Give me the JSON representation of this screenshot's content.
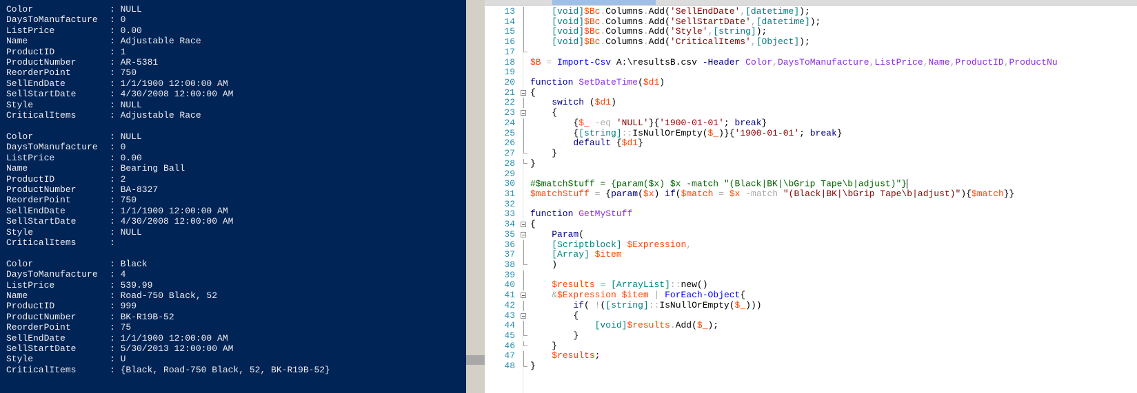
{
  "console": {
    "records": [
      [
        {
          "k": "Color",
          "v": "NULL"
        },
        {
          "k": "DaysToManufacture",
          "v": "0"
        },
        {
          "k": "ListPrice",
          "v": "0.00"
        },
        {
          "k": "Name",
          "v": "Adjustable Race"
        },
        {
          "k": "ProductID",
          "v": "1"
        },
        {
          "k": "ProductNumber",
          "v": "AR-5381"
        },
        {
          "k": "ReorderPoint",
          "v": "750"
        },
        {
          "k": "SellEndDate",
          "v": "1/1/1900 12:00:00 AM"
        },
        {
          "k": "SellStartDate",
          "v": "4/30/2008 12:00:00 AM"
        },
        {
          "k": "Style",
          "v": "NULL"
        },
        {
          "k": "CriticalItems",
          "v": "Adjustable Race"
        }
      ],
      [
        {
          "k": "Color",
          "v": "NULL"
        },
        {
          "k": "DaysToManufacture",
          "v": "0"
        },
        {
          "k": "ListPrice",
          "v": "0.00"
        },
        {
          "k": "Name",
          "v": "Bearing Ball"
        },
        {
          "k": "ProductID",
          "v": "2"
        },
        {
          "k": "ProductNumber",
          "v": "BA-8327"
        },
        {
          "k": "ReorderPoint",
          "v": "750"
        },
        {
          "k": "SellEndDate",
          "v": "1/1/1900 12:00:00 AM"
        },
        {
          "k": "SellStartDate",
          "v": "4/30/2008 12:00:00 AM"
        },
        {
          "k": "Style",
          "v": "NULL"
        },
        {
          "k": "CriticalItems",
          "v": ""
        }
      ],
      [
        {
          "k": "Color",
          "v": "Black"
        },
        {
          "k": "DaysToManufacture",
          "v": "4"
        },
        {
          "k": "ListPrice",
          "v": "539.99"
        },
        {
          "k": "Name",
          "v": "Road-750 Black, 52"
        },
        {
          "k": "ProductID",
          "v": "999"
        },
        {
          "k": "ProductNumber",
          "v": "BK-R19B-52"
        },
        {
          "k": "ReorderPoint",
          "v": "75"
        },
        {
          "k": "SellEndDate",
          "v": "1/1/1900 12:00:00 AM"
        },
        {
          "k": "SellStartDate",
          "v": "5/30/2013 12:00:00 AM"
        },
        {
          "k": "Style",
          "v": "U"
        },
        {
          "k": "CriticalItems",
          "v": "{Black, Road-750 Black, 52, BK-R19B-52}"
        }
      ]
    ]
  },
  "colors": {
    "console_bg": "#012456",
    "console_fg": "#eeedf0",
    "line_number": "#2b91af",
    "variable": "#ff4500",
    "type": "#008080",
    "string": "#8b0000",
    "keyword": "#00008b",
    "command": "#0000ff",
    "comment": "#006400",
    "argument": "#8a2be2"
  },
  "editor": {
    "lines": [
      {
        "n": "13",
        "fold": "line",
        "t": [
          [
            "plain",
            "    "
          ],
          [
            "type",
            "[void]"
          ],
          [
            "var",
            "$Bc"
          ],
          [
            "op",
            "."
          ],
          [
            "member",
            "Columns"
          ],
          [
            "op",
            "."
          ],
          [
            "member",
            "Add"
          ],
          [
            "grp",
            "("
          ],
          [
            "str",
            "'SellEndDate'"
          ],
          [
            "op",
            ","
          ],
          [
            "type",
            "[datetime]"
          ],
          [
            "grp",
            ");"
          ]
        ]
      },
      {
        "n": "14",
        "fold": "line",
        "t": [
          [
            "plain",
            "    "
          ],
          [
            "type",
            "[void]"
          ],
          [
            "var",
            "$Bc"
          ],
          [
            "op",
            "."
          ],
          [
            "member",
            "Columns"
          ],
          [
            "op",
            "."
          ],
          [
            "member",
            "Add"
          ],
          [
            "grp",
            "("
          ],
          [
            "str",
            "'SellStartDate'"
          ],
          [
            "op",
            ","
          ],
          [
            "type",
            "[datetime]"
          ],
          [
            "grp",
            ");"
          ]
        ]
      },
      {
        "n": "15",
        "fold": "line",
        "t": [
          [
            "plain",
            "    "
          ],
          [
            "type",
            "[void]"
          ],
          [
            "var",
            "$Bc"
          ],
          [
            "op",
            "."
          ],
          [
            "member",
            "Columns"
          ],
          [
            "op",
            "."
          ],
          [
            "member",
            "Add"
          ],
          [
            "grp",
            "("
          ],
          [
            "str",
            "'Style'"
          ],
          [
            "op",
            ","
          ],
          [
            "type",
            "[string]"
          ],
          [
            "grp",
            ");"
          ]
        ]
      },
      {
        "n": "16",
        "fold": "line",
        "t": [
          [
            "plain",
            "    "
          ],
          [
            "type",
            "[void]"
          ],
          [
            "var",
            "$Bc"
          ],
          [
            "op",
            "."
          ],
          [
            "member",
            "Columns"
          ],
          [
            "op",
            "."
          ],
          [
            "member",
            "Add"
          ],
          [
            "grp",
            "("
          ],
          [
            "str",
            "'CriticalItems'"
          ],
          [
            "op",
            ","
          ],
          [
            "type",
            "[Object]"
          ],
          [
            "grp",
            ");"
          ]
        ]
      },
      {
        "n": "17",
        "fold": "end",
        "t": []
      },
      {
        "n": "18",
        "fold": "",
        "t": [
          [
            "var",
            "$B"
          ],
          [
            "plain",
            " "
          ],
          [
            "op",
            "="
          ],
          [
            "plain",
            " "
          ],
          [
            "cmd",
            "Import-Csv"
          ],
          [
            "plain",
            " "
          ],
          [
            "plain",
            "A:\\resultsB.csv"
          ],
          [
            "plain",
            " "
          ],
          [
            "param",
            "-Header"
          ],
          [
            "plain",
            " "
          ],
          [
            "arg",
            "Color"
          ],
          [
            "op",
            ","
          ],
          [
            "arg",
            "DaysToManufacture"
          ],
          [
            "op",
            ","
          ],
          [
            "arg",
            "ListPrice"
          ],
          [
            "op",
            ","
          ],
          [
            "arg",
            "Name"
          ],
          [
            "op",
            ","
          ],
          [
            "arg",
            "ProductID"
          ],
          [
            "op",
            ","
          ],
          [
            "arg",
            "ProductNu"
          ]
        ]
      },
      {
        "n": "19",
        "fold": "",
        "t": []
      },
      {
        "n": "20",
        "fold": "",
        "t": [
          [
            "kw",
            "function"
          ],
          [
            "plain",
            " "
          ],
          [
            "arg",
            "SetDateTime"
          ],
          [
            "grp",
            "("
          ],
          [
            "var",
            "$d1"
          ],
          [
            "grp",
            ")"
          ]
        ]
      },
      {
        "n": "21",
        "fold": "box",
        "t": [
          [
            "grp",
            "{"
          ]
        ]
      },
      {
        "n": "22",
        "fold": "line",
        "t": [
          [
            "plain",
            "    "
          ],
          [
            "kw",
            "switch"
          ],
          [
            "plain",
            " "
          ],
          [
            "grp",
            "("
          ],
          [
            "var",
            "$d1"
          ],
          [
            "grp",
            ")"
          ]
        ]
      },
      {
        "n": "23",
        "fold": "box",
        "t": [
          [
            "plain",
            "    "
          ],
          [
            "grp",
            "{"
          ]
        ]
      },
      {
        "n": "24",
        "fold": "line",
        "t": [
          [
            "plain",
            "        "
          ],
          [
            "grp",
            "{"
          ],
          [
            "var",
            "$_"
          ],
          [
            "plain",
            " "
          ],
          [
            "op",
            "-eq"
          ],
          [
            "plain",
            " "
          ],
          [
            "str",
            "'NULL'"
          ],
          [
            "grp",
            "}{"
          ],
          [
            "str",
            "'1900-01-01'"
          ],
          [
            "plain",
            "; "
          ],
          [
            "kw",
            "break"
          ],
          [
            "grp",
            "}"
          ]
        ]
      },
      {
        "n": "25",
        "fold": "line",
        "t": [
          [
            "plain",
            "        "
          ],
          [
            "grp",
            "{"
          ],
          [
            "type",
            "[string]"
          ],
          [
            "op",
            "::"
          ],
          [
            "member",
            "IsNullOrEmpty"
          ],
          [
            "grp",
            "("
          ],
          [
            "var",
            "$_"
          ],
          [
            "grp",
            ")}{"
          ],
          [
            "str",
            "'1900-01-01'"
          ],
          [
            "plain",
            "; "
          ],
          [
            "kw",
            "break"
          ],
          [
            "grp",
            "}"
          ]
        ]
      },
      {
        "n": "26",
        "fold": "line",
        "t": [
          [
            "plain",
            "        "
          ],
          [
            "kw",
            "default"
          ],
          [
            "plain",
            " "
          ],
          [
            "grp",
            "{"
          ],
          [
            "var",
            "$d1"
          ],
          [
            "grp",
            "}"
          ]
        ]
      },
      {
        "n": "27",
        "fold": "end",
        "t": [
          [
            "plain",
            "    "
          ],
          [
            "grp",
            "}"
          ]
        ]
      },
      {
        "n": "28",
        "fold": "end",
        "t": [
          [
            "grp",
            "}"
          ]
        ]
      },
      {
        "n": "29",
        "fold": "",
        "t": []
      },
      {
        "n": "30",
        "fold": "",
        "t": [
          [
            "com",
            "#$matchStuff = {param($x) $x -match \"(Black|BK|\\bGrip Tape\\b|adjust)\"}"
          ],
          [
            "caret",
            ""
          ]
        ]
      },
      {
        "n": "31",
        "fold": "",
        "t": [
          [
            "var",
            "$matchStuff"
          ],
          [
            "plain",
            " "
          ],
          [
            "op",
            "="
          ],
          [
            "plain",
            " "
          ],
          [
            "grp",
            "{"
          ],
          [
            "kw",
            "param"
          ],
          [
            "grp",
            "("
          ],
          [
            "var",
            "$x"
          ],
          [
            "grp",
            ")"
          ],
          [
            "plain",
            " "
          ],
          [
            "kw",
            "if"
          ],
          [
            "grp",
            "("
          ],
          [
            "var",
            "$match"
          ],
          [
            "plain",
            " "
          ],
          [
            "op",
            "="
          ],
          [
            "plain",
            " "
          ],
          [
            "var",
            "$x"
          ],
          [
            "plain",
            " "
          ],
          [
            "op",
            "-match"
          ],
          [
            "plain",
            " "
          ],
          [
            "str",
            "\"(Black|BK|\\bGrip Tape\\b|adjust)\""
          ],
          [
            "grp",
            ")"
          ],
          [
            "grp",
            "{"
          ],
          [
            "var",
            "$match"
          ],
          [
            "grp",
            "}}"
          ]
        ]
      },
      {
        "n": "32",
        "fold": "",
        "t": []
      },
      {
        "n": "33",
        "fold": "",
        "t": [
          [
            "kw",
            "function"
          ],
          [
            "plain",
            " "
          ],
          [
            "arg",
            "GetMyStuff"
          ]
        ]
      },
      {
        "n": "34",
        "fold": "box",
        "t": [
          [
            "grp",
            "{"
          ]
        ]
      },
      {
        "n": "35",
        "fold": "box",
        "t": [
          [
            "plain",
            "    "
          ],
          [
            "kw",
            "Param"
          ],
          [
            "grp",
            "("
          ]
        ]
      },
      {
        "n": "36",
        "fold": "line",
        "t": [
          [
            "plain",
            "    "
          ],
          [
            "type",
            "[Scriptblock]"
          ],
          [
            "plain",
            " "
          ],
          [
            "var",
            "$Expression"
          ],
          [
            "op",
            ","
          ]
        ]
      },
      {
        "n": "37",
        "fold": "line",
        "t": [
          [
            "plain",
            "    "
          ],
          [
            "type",
            "[Array]"
          ],
          [
            "plain",
            " "
          ],
          [
            "var",
            "$item"
          ]
        ]
      },
      {
        "n": "38",
        "fold": "end",
        "t": [
          [
            "plain",
            "    "
          ],
          [
            "grp",
            ")"
          ]
        ]
      },
      {
        "n": "39",
        "fold": "line",
        "t": []
      },
      {
        "n": "40",
        "fold": "line",
        "t": [
          [
            "plain",
            "    "
          ],
          [
            "var",
            "$results"
          ],
          [
            "plain",
            " "
          ],
          [
            "op",
            "="
          ],
          [
            "plain",
            " "
          ],
          [
            "type",
            "[ArrayList]"
          ],
          [
            "op",
            "::"
          ],
          [
            "member",
            "new"
          ],
          [
            "grp",
            "()"
          ]
        ]
      },
      {
        "n": "41",
        "fold": "box",
        "t": [
          [
            "plain",
            "    "
          ],
          [
            "op",
            "&"
          ],
          [
            "var",
            "$Expression"
          ],
          [
            "plain",
            " "
          ],
          [
            "var",
            "$item"
          ],
          [
            "plain",
            " "
          ],
          [
            "op",
            "|"
          ],
          [
            "plain",
            " "
          ],
          [
            "cmd",
            "ForEach-Object"
          ],
          [
            "grp",
            "{"
          ]
        ]
      },
      {
        "n": "42",
        "fold": "line",
        "t": [
          [
            "plain",
            "        "
          ],
          [
            "kw",
            "if"
          ],
          [
            "grp",
            "("
          ],
          [
            "plain",
            " "
          ],
          [
            "op",
            "!"
          ],
          [
            "grp",
            "("
          ],
          [
            "type",
            "[string]"
          ],
          [
            "op",
            "::"
          ],
          [
            "member",
            "IsNullOrEmpty"
          ],
          [
            "grp",
            "("
          ],
          [
            "var",
            "$_"
          ],
          [
            "grp",
            ")))"
          ]
        ]
      },
      {
        "n": "43",
        "fold": "box",
        "t": [
          [
            "plain",
            "        "
          ],
          [
            "grp",
            "{"
          ]
        ]
      },
      {
        "n": "44",
        "fold": "line",
        "t": [
          [
            "plain",
            "            "
          ],
          [
            "type",
            "[void]"
          ],
          [
            "var",
            "$results"
          ],
          [
            "op",
            "."
          ],
          [
            "member",
            "Add"
          ],
          [
            "grp",
            "("
          ],
          [
            "var",
            "$_"
          ],
          [
            "grp",
            ");"
          ]
        ]
      },
      {
        "n": "45",
        "fold": "end",
        "t": [
          [
            "plain",
            "        "
          ],
          [
            "grp",
            "}"
          ]
        ]
      },
      {
        "n": "46",
        "fold": "end",
        "t": [
          [
            "plain",
            "    "
          ],
          [
            "grp",
            "}"
          ]
        ]
      },
      {
        "n": "47",
        "fold": "line",
        "t": [
          [
            "plain",
            "    "
          ],
          [
            "var",
            "$results"
          ],
          [
            "plain",
            ";"
          ]
        ]
      },
      {
        "n": "48",
        "fold": "end",
        "t": [
          [
            "grp",
            "}"
          ]
        ]
      }
    ]
  }
}
